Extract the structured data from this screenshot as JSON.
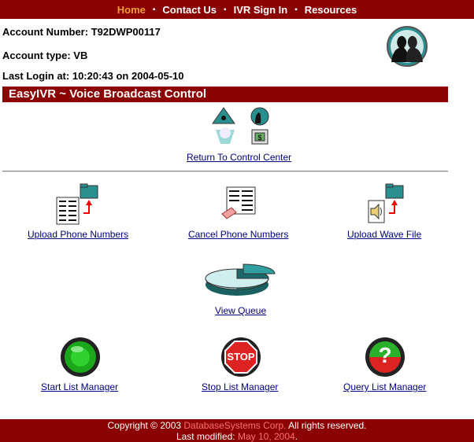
{
  "nav": {
    "home": "Home",
    "contact": "Contact Us",
    "ivr_sign_in": "IVR Sign In",
    "resources": "Resources",
    "separator": "▪"
  },
  "account": {
    "number_label": "Account Number:",
    "number_value": "T92DWP00117",
    "type_label": "Account type:",
    "type_value": "VB",
    "login_label": "Last Login at:",
    "login_value": "10:20:43 on 2004-05-10"
  },
  "section_title": "EasyIVR ~ Voice Broadcast Control",
  "links": {
    "return": "Return To Control Center",
    "upload_phone": "Upload Phone Numbers",
    "cancel_phone": "Cancel Phone Numbers",
    "upload_wave": "Upload Wave File",
    "view_queue": "View Queue",
    "start_list": "Start List Manager",
    "stop_list": "Stop List Manager",
    "query_list": "Query List Manager"
  },
  "icons": {
    "stop_text": "STOP",
    "query_text": "?"
  },
  "footer": {
    "copyright_prefix": "Copyright © 2003 ",
    "company": "DatabaseSystems Corp.",
    "copyright_suffix": " All rights reserved.",
    "modified_prefix": "Last modified: ",
    "modified_date": "May 10, 2004",
    "modified_suffix": "."
  },
  "colors": {
    "brand_red": "#8b0000",
    "nav_active": "#f0a030",
    "link": "#000080",
    "teal": "#2a8f8f"
  }
}
